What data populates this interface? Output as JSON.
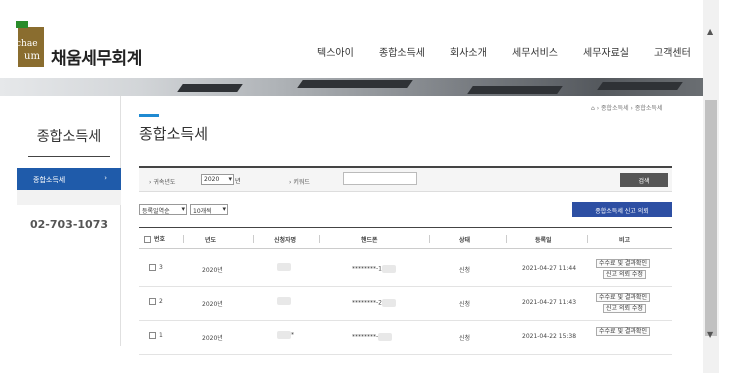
{
  "header": {
    "logo_line1": "chae",
    "logo_line2": "um",
    "brand": "채움세무회계",
    "nav": [
      "텍스아이",
      "종합소득세",
      "회사소개",
      "세무서비스",
      "세무자료실",
      "고객센터"
    ]
  },
  "sidebar": {
    "title": "종합소득세",
    "menu_item": "종합소득세",
    "phone": "02-703-1073"
  },
  "main": {
    "title": "종합소득세",
    "breadcrumb": [
      "종합소득세",
      "종합소득세"
    ],
    "search": {
      "year_label": "귀속년도",
      "year_value": "2020",
      "year_unit": "년",
      "keyword_label": "키워드",
      "search_button": "검색"
    },
    "sort_select": "등록일역순",
    "page_size_select": "10개씩",
    "apply_button": "종합소득세 신고 의뢰",
    "table": {
      "headers": [
        "번호",
        "년도",
        "신청자명",
        "핸드폰",
        "상태",
        "등록일",
        "비고"
      ],
      "rows": [
        {
          "no": "3",
          "year": "2020년",
          "name_suffix": "",
          "phone": "********-1",
          "status": "신청",
          "date": "2021-04-27 11:44",
          "btn1": "수수료 및 결과확인",
          "btn2": "신고 의뢰 수정"
        },
        {
          "no": "2",
          "year": "2020년",
          "name_suffix": "",
          "phone": "********-2",
          "status": "신청",
          "date": "2021-04-27 11:43",
          "btn1": "수수료 및 결과확인",
          "btn2": "신고 의뢰 수정"
        },
        {
          "no": "1",
          "year": "2020년",
          "name_suffix": "*",
          "phone": "********-",
          "status": "신청",
          "date": "2021-04-22 15:38",
          "btn1": "수수료 및 결과확인",
          "btn2": ""
        }
      ]
    }
  }
}
